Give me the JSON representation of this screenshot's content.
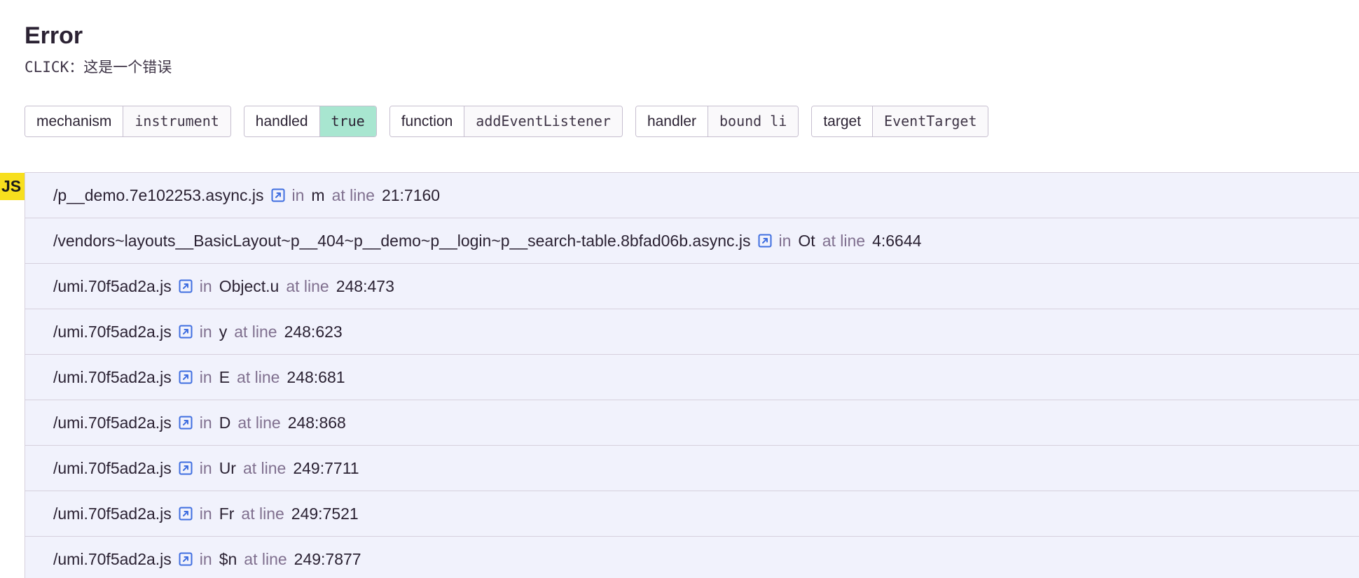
{
  "error": {
    "title": "Error",
    "message": "CLICK：这是一个错误"
  },
  "tags": [
    {
      "key": "mechanism",
      "value": "instrument",
      "highlight": false
    },
    {
      "key": "handled",
      "value": "true",
      "highlight": true
    },
    {
      "key": "function",
      "value": "addEventListener",
      "highlight": false
    },
    {
      "key": "handler",
      "value": "bound li",
      "highlight": false
    },
    {
      "key": "target",
      "value": "EventTarget",
      "highlight": false
    }
  ],
  "platform_badge": "JS",
  "frame_labels": {
    "in": "in",
    "at_line": "at line"
  },
  "frames": [
    {
      "file": "/p__demo.7e102253.async.js",
      "function": "m",
      "line": "21:7160"
    },
    {
      "file": "/vendors~layouts__BasicLayout~p__404~p__demo~p__login~p__search-table.8bfad06b.async.js",
      "function": "Ot",
      "line": "4:6644"
    },
    {
      "file": "/umi.70f5ad2a.js",
      "function": "Object.u",
      "line": "248:473"
    },
    {
      "file": "/umi.70f5ad2a.js",
      "function": "y",
      "line": "248:623"
    },
    {
      "file": "/umi.70f5ad2a.js",
      "function": "E",
      "line": "248:681"
    },
    {
      "file": "/umi.70f5ad2a.js",
      "function": "D",
      "line": "248:868"
    },
    {
      "file": "/umi.70f5ad2a.js",
      "function": "Ur",
      "line": "249:7711"
    },
    {
      "file": "/umi.70f5ad2a.js",
      "function": "Fr",
      "line": "249:7521"
    },
    {
      "file": "/umi.70f5ad2a.js",
      "function": "$n",
      "line": "249:7877"
    }
  ],
  "colors": {
    "tag_true_bg": "#a8e6d0",
    "js_badge": "#f7df1e",
    "frame_bg": "#f1f2fc",
    "link_icon": "#3f6ee0"
  }
}
